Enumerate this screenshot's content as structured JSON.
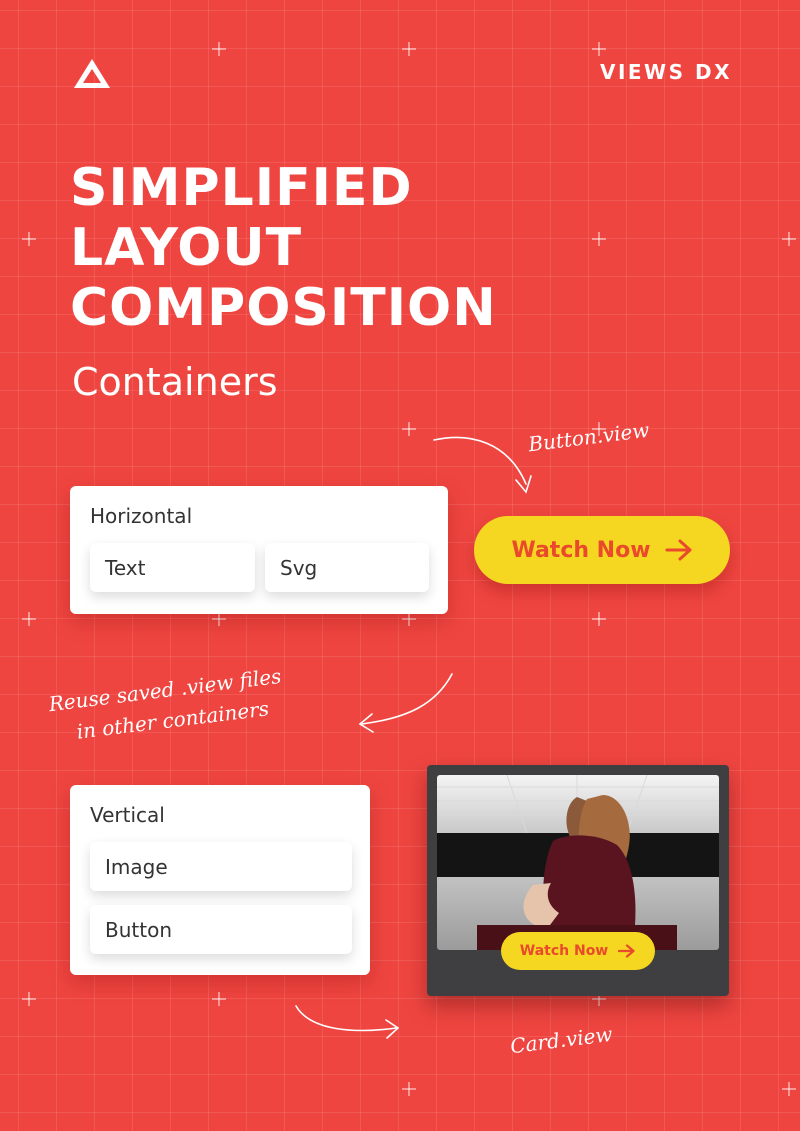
{
  "brand": "VIEWS DX",
  "title_lines": [
    "SIMPLIFIED",
    "LAYOUT",
    "COMPOSITION"
  ],
  "subtitle": "Containers",
  "horizontal": {
    "label": "Horizontal",
    "items": [
      "Text",
      "Svg"
    ]
  },
  "vertical": {
    "label": "Vertical",
    "items": [
      "Image",
      "Button"
    ]
  },
  "watch_button": {
    "label": "Watch Now"
  },
  "card": {
    "button_label": "Watch Now"
  },
  "notes": {
    "button_view": "Button.view",
    "reuse_line1": "Reuse saved .view files",
    "reuse_line2": "in other containers",
    "card_view": "Card.view"
  },
  "colors": {
    "background": "#ef4540",
    "accent_yellow": "#f5d620",
    "accent_orange": "#ea4a2c",
    "card_dark": "#3f3f42"
  },
  "icons": {
    "logo": "triangle-logo-icon",
    "arrow": "arrow-right-icon"
  }
}
